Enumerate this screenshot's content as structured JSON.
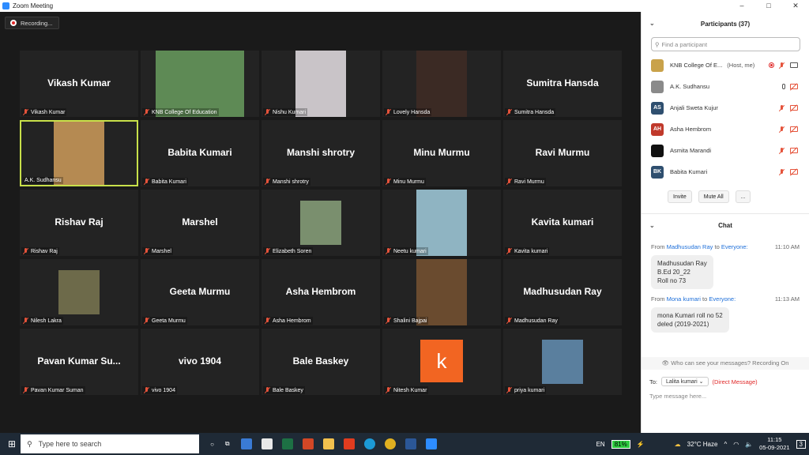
{
  "window": {
    "title": "Zoom Meeting",
    "controls": [
      "–",
      "□",
      "✕"
    ]
  },
  "recording": {
    "label": "Recording..."
  },
  "tiles": [
    {
      "big": "Vikash Kumar",
      "caption": "Vikash Kumar",
      "type": "name"
    },
    {
      "big": "",
      "caption": "KNB College Of Education",
      "type": "photo",
      "color": "#5e8a55"
    },
    {
      "big": "",
      "caption": "Nishu Kumari",
      "type": "photo",
      "color": "#c9c4c8"
    },
    {
      "big": "",
      "caption": "Lovely Hansda",
      "type": "photo",
      "color": "#3b2a24"
    },
    {
      "big": "Sumitra Hansda",
      "caption": "Sumitra Hansda",
      "type": "name"
    },
    {
      "big": "",
      "caption": "A.K. Sudhansu",
      "type": "photo",
      "color": "#b58a52",
      "active": true
    },
    {
      "big": "Babita Kumari",
      "caption": "Babita Kumari",
      "type": "name"
    },
    {
      "big": "Manshi shrotry",
      "caption": "Manshi shrotry",
      "type": "name"
    },
    {
      "big": "Minu Murmu",
      "caption": "Minu Murmu",
      "type": "name"
    },
    {
      "big": "Ravi Murmu",
      "caption": "Ravi Murmu",
      "type": "name"
    },
    {
      "big": "Rishav Raj",
      "caption": "Rishav Raj",
      "type": "name"
    },
    {
      "big": "Marshel",
      "caption": "Marshel",
      "type": "name"
    },
    {
      "big": "",
      "caption": "Elizabeth Soren",
      "type": "photo",
      "color": "#7a8f6e"
    },
    {
      "big": "",
      "caption": "Neetu kumari",
      "type": "photo",
      "color": "#8fb4c2"
    },
    {
      "big": "Kavita kumari",
      "caption": "Kavita kumari",
      "type": "name"
    },
    {
      "big": "",
      "caption": "Nilesh Lakra",
      "type": "photo",
      "color": "#6d6a4a"
    },
    {
      "big": "Geeta Murmu",
      "caption": "Geeta Murmu",
      "type": "name"
    },
    {
      "big": "Asha Hembrom",
      "caption": "Asha Hembrom",
      "type": "name"
    },
    {
      "big": "",
      "caption": "Shalini Bajpai",
      "type": "photo",
      "color": "#6a4b2f"
    },
    {
      "big": "Madhusudan Ray",
      "caption": "Madhusudan Ray",
      "type": "name"
    },
    {
      "big": "Pavan Kumar Su...",
      "caption": "Pavan Kumar Suman",
      "type": "name"
    },
    {
      "big": "vivo 1904",
      "caption": "vivo 1904",
      "type": "name"
    },
    {
      "big": "Bale Baskey",
      "caption": "Bale Baskey",
      "type": "name"
    },
    {
      "big": "k",
      "caption": "Nitesh Kumar",
      "type": "letter",
      "color": "#f26522"
    },
    {
      "big": "",
      "caption": "priya kumari",
      "type": "photo",
      "color": "#5a7f9e"
    }
  ],
  "participants": {
    "title": "Participants (37)",
    "search_placeholder": "Find a participant",
    "list": [
      {
        "name": "KNB College Of E...",
        "tag": "(Host, me)",
        "initials": "",
        "color": "#c9a24a",
        "mic": "off",
        "cam": "on",
        "rec": true
      },
      {
        "name": "A.K. Sudhansu",
        "tag": "",
        "initials": "",
        "color": "#8a8a8a",
        "mic": "on",
        "cam": "off",
        "rec": false
      },
      {
        "name": "Anjali Sweta Kujur",
        "tag": "",
        "initials": "AS",
        "color": "#2f4f6f",
        "mic": "off",
        "cam": "off",
        "rec": false
      },
      {
        "name": "Asha Hembrom",
        "tag": "",
        "initials": "AH",
        "color": "#c0392b",
        "mic": "off",
        "cam": "off",
        "rec": false
      },
      {
        "name": "Asmita Marandi",
        "tag": "",
        "initials": "",
        "color": "#111111",
        "mic": "off",
        "cam": "off",
        "rec": false
      },
      {
        "name": "Babita Kumari",
        "tag": "",
        "initials": "BK",
        "color": "#2f4f6f",
        "mic": "off",
        "cam": "off",
        "rec": false
      }
    ],
    "buttons": [
      "Invite",
      "Mute All",
      "..."
    ]
  },
  "chat": {
    "title": "Chat",
    "messages": [
      {
        "from": "Madhusudan Ray",
        "to_word": "to",
        "to": "Everyone:",
        "time": "11:10 AM",
        "lines": [
          "Madhusudan Ray",
          "B.Ed 20_22",
          "Roll no 73"
        ]
      },
      {
        "from": "Mona kumari",
        "to_word": "to",
        "to": "Everyone:",
        "time": "11:13 AM",
        "lines": [
          "mona Kumari roll no 52",
          "deled (2019-2021)"
        ]
      }
    ],
    "from_word": "From",
    "visibility": "Who can see your messages? Recording On",
    "to_label": "To:",
    "to_value": "Lalita kumari",
    "dm_label": "(Direct Message)",
    "input_placeholder": "Type message here..."
  },
  "taskbar": {
    "search_placeholder": "Type here to search",
    "lang": "EN",
    "battery": "81%",
    "weather": "32°C  Haze",
    "time": "11:15",
    "date": "05-09-2021",
    "notif_count": "3"
  }
}
